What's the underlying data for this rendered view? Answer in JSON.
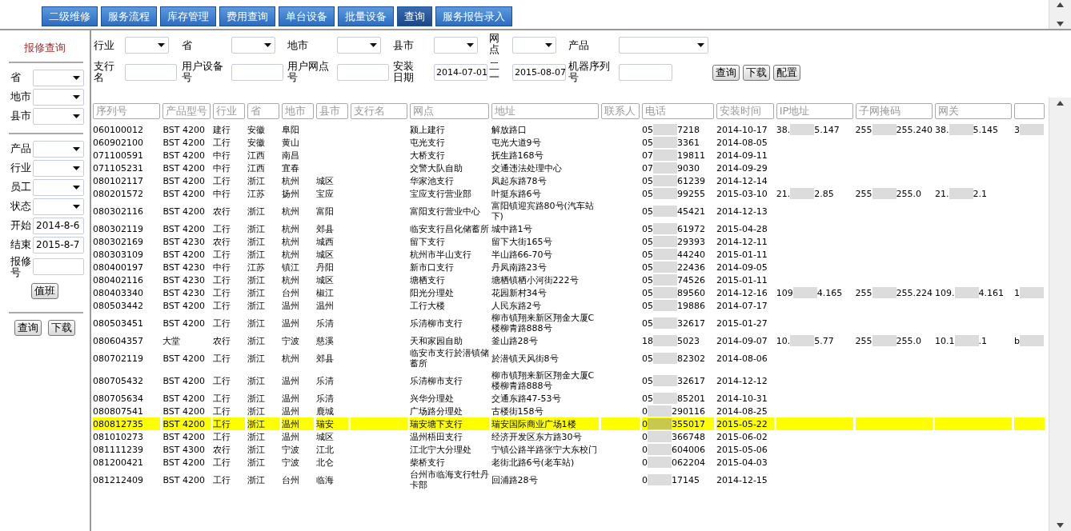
{
  "tabs": [
    {
      "label": "二级维修",
      "selected": false
    },
    {
      "label": "服务流程",
      "selected": false
    },
    {
      "label": "库存管理",
      "selected": false
    },
    {
      "label": "费用查询",
      "selected": false
    },
    {
      "label": "单台设备",
      "selected": false
    },
    {
      "label": "批量设备",
      "selected": false
    },
    {
      "label": "查询",
      "selected": true
    },
    {
      "label": "服务报告录入",
      "selected": false
    }
  ],
  "sidebar": {
    "title": "报修查询",
    "groups": [
      [
        {
          "kind": "select",
          "label": "省"
        },
        {
          "kind": "select",
          "label": "地市"
        },
        {
          "kind": "select",
          "label": "县市"
        }
      ],
      [
        {
          "kind": "select",
          "label": "产品"
        },
        {
          "kind": "select",
          "label": "行业"
        },
        {
          "kind": "select",
          "label": "员工"
        },
        {
          "kind": "select",
          "label": "状态"
        },
        {
          "kind": "input",
          "label": "开始",
          "value": "2014-8-6"
        },
        {
          "kind": "input",
          "label": "结束",
          "value": "2015-8-7"
        },
        {
          "kind": "input",
          "label": "报修号"
        }
      ]
    ],
    "duty_button": "值班",
    "buttons": [
      "查询",
      "下载"
    ]
  },
  "filters": {
    "rows": [
      [
        {
          "kind": "select",
          "label": "行业"
        },
        {
          "kind": "select",
          "label": "省"
        },
        {
          "kind": "select",
          "label": "地市"
        },
        {
          "kind": "select",
          "label": "县市"
        },
        {
          "kind": "select",
          "label": "网点"
        },
        {
          "kind": "select",
          "label": "产品"
        }
      ],
      [
        {
          "kind": "input",
          "label": "支行名"
        },
        {
          "kind": "input",
          "label": "用户设备号"
        },
        {
          "kind": "input",
          "label": "用户网点号"
        },
        {
          "kind": "input",
          "label": "安装日期",
          "value": "2014-07-01"
        },
        {
          "kind": "input",
          "label": "二一",
          "value": "2015-08-07"
        },
        {
          "kind": "input",
          "label": "机器序列号"
        }
      ]
    ],
    "buttons": [
      "查询",
      "下载",
      "配置"
    ]
  },
  "table": {
    "columns": [
      "序列号",
      "产品型号",
      "行业",
      "省",
      "地市",
      "县市",
      "支行名",
      "网点",
      "地址",
      "联系人",
      "电话",
      "安装时间",
      "IP地址",
      "子网掩码",
      "网关"
    ],
    "rows": [
      {
        "selected": false,
        "cells": [
          "060100012",
          "BST 4200",
          "建行",
          "安徽",
          "阜阳",
          "",
          "",
          "颍上建行",
          "解放路口",
          "",
          [
            "05",
            "7218"
          ],
          "2014-10-17",
          [
            "38.",
            "5.147"
          ],
          [
            "255",
            "255.240"
          ],
          [
            "38.",
            "5.145"
          ],
          [
            "3"
          ]
        ]
      },
      {
        "selected": false,
        "cells": [
          "060902100",
          "BST 4200",
          "工行",
          "安徽",
          "黄山",
          "",
          "",
          "屯光支行",
          "屯光大道9号",
          "",
          [
            "05",
            "3361"
          ],
          "2014-08-05"
        ]
      },
      {
        "selected": false,
        "cells": [
          "071100591",
          "BST 4200",
          "中行",
          "江西",
          "南昌",
          "",
          "",
          "大桥支行",
          "抚生路168号",
          "",
          [
            "07",
            "19811"
          ],
          "2014-09-11"
        ]
      },
      {
        "selected": false,
        "cells": [
          "071105231",
          "BST 4200",
          "中行",
          "江西",
          "宜春",
          "",
          "",
          "交警大队自助",
          "交通违法处理中心",
          "",
          [
            "07",
            "9030"
          ],
          "2014-09-29"
        ]
      },
      {
        "selected": false,
        "cells": [
          "080102117",
          "BST 4200",
          "工行",
          "浙江",
          "杭州",
          "城区",
          "",
          "华家池支行",
          "凤起东路78号",
          "",
          [
            "05",
            "61239"
          ],
          "2014-12-14"
        ]
      },
      {
        "selected": false,
        "cells": [
          "080201572",
          "BST 4200",
          "中行",
          "江苏",
          "扬州",
          "宝应",
          "",
          "宝应支行营业部",
          "叶挺东路6号",
          "",
          [
            "05",
            "99255"
          ],
          "2015-03-10",
          [
            "21.",
            "2.85"
          ],
          [
            "255",
            "255.0"
          ],
          [
            "21.",
            "2.1"
          ]
        ]
      },
      {
        "selected": false,
        "cells": [
          "080302116",
          "BST 4200",
          "农行",
          "浙江",
          "杭州",
          "富阳",
          "",
          "富阳支行营业中心",
          "富阳镇迎宾路80号(汽车站下)",
          "",
          [
            "05",
            "45421"
          ],
          "2014-12-13"
        ]
      },
      {
        "selected": false,
        "cells": [
          "080302119",
          "BST 4200",
          "工行",
          "浙江",
          "杭州",
          "郊县",
          "",
          "临安支行昌化储蓄所",
          "城中路1号",
          "",
          [
            "05",
            "61972"
          ],
          "2015-04-28"
        ]
      },
      {
        "selected": false,
        "cells": [
          "080302169",
          "BST 4230",
          "农行",
          "浙江",
          "杭州",
          "城西",
          "",
          "留下支行",
          "留下大街165号",
          "",
          [
            "05",
            "29393"
          ],
          "2014-12-11"
        ]
      },
      {
        "selected": false,
        "cells": [
          "080303109",
          "BST 4200",
          "工行",
          "浙江",
          "杭州",
          "城区",
          "",
          "杭州市半山支行",
          "半山路66-70号",
          "",
          [
            "05",
            "44240"
          ],
          "2015-01-11"
        ]
      },
      {
        "selected": false,
        "cells": [
          "080400197",
          "BST 4230",
          "中行",
          "江苏",
          "镇江",
          "丹阳",
          "",
          "新市口支行",
          "丹凤南路23号",
          "",
          [
            "05",
            "22436"
          ],
          "2014-09-05"
        ]
      },
      {
        "selected": false,
        "cells": [
          "080402116",
          "BST 4230",
          "工行",
          "浙江",
          "杭州",
          "城区",
          "",
          "塘栖支行",
          "塘栖镇栖小河街222号",
          "",
          [
            "05",
            "74526"
          ],
          "2015-01-11"
        ]
      },
      {
        "selected": false,
        "cells": [
          "080403340",
          "BST 4230",
          "工行",
          "浙江",
          "台州",
          "椒江",
          "",
          "阳光分理处",
          "花园新村34号",
          "",
          [
            "05",
            "89560"
          ],
          "2014-12-16",
          [
            "109",
            "4.165"
          ],
          [
            "255",
            "255.224"
          ],
          [
            "109.",
            "4.161"
          ],
          [
            "1"
          ]
        ]
      },
      {
        "selected": false,
        "cells": [
          "080503442",
          "BST 4200",
          "工行",
          "浙江",
          "温州",
          "温州",
          "",
          "工行大楼",
          "人民东路2号",
          "",
          [
            "05",
            "19886"
          ],
          "2014-07-17"
        ]
      },
      {
        "selected": false,
        "cells": [
          "080503451",
          "BST 4200",
          "工行",
          "浙江",
          "温州",
          "乐清",
          "",
          "乐清柳市支行",
          "柳市镇翔来新区翔金大厦C楼柳青路888号",
          "",
          [
            "05",
            "32617"
          ],
          "2015-01-27"
        ]
      },
      {
        "selected": false,
        "cells": [
          "080604357",
          "大堂",
          "农行",
          "浙江",
          "宁波",
          "慈溪",
          "",
          "天和家园自助",
          "釜山路28号",
          "",
          [
            "18",
            "5023"
          ],
          "2014-09-07",
          [
            "10.",
            "5.77"
          ],
          [
            "255",
            "255.0"
          ],
          [
            "10.1",
            ".1"
          ],
          [
            "b"
          ]
        ]
      },
      {
        "selected": false,
        "cells": [
          "080702119",
          "BST 4200",
          "工行",
          "浙江",
          "杭州",
          "郊县",
          "",
          "临安市支行於潜镇储蓄所",
          "於潜镇天风街8号",
          "",
          [
            "05",
            "82302"
          ],
          "2014-08-06"
        ]
      },
      {
        "selected": false,
        "cells": [
          "080705432",
          "BST 4200",
          "工行",
          "浙江",
          "温州",
          "乐清",
          "",
          "乐清柳市支行",
          "柳市镇翔来新区翔金大厦C楼柳青路888号",
          "",
          [
            "05",
            "32617"
          ],
          "2014-12-12"
        ]
      },
      {
        "selected": false,
        "cells": [
          "080705634",
          "BST 4200",
          "工行",
          "浙江",
          "温州",
          "乐清",
          "",
          "兴华分理处",
          "交通东路47-53号",
          "",
          [
            "05",
            "85201"
          ],
          "2014-10-31"
        ]
      },
      {
        "selected": false,
        "cells": [
          "080807541",
          "BST 4200",
          "工行",
          "浙江",
          "温州",
          "鹿城",
          "",
          "广场路分理处",
          "古楼街158号",
          "",
          [
            "0",
            "290116"
          ],
          "2014-08-25"
        ]
      },
      {
        "selected": true,
        "cells": [
          "080812735",
          "BST 4200",
          "工行",
          "浙江",
          "温州",
          "瑞安",
          "",
          "瑞安塘下支行",
          "瑞安国际商业广场1楼",
          "",
          [
            "0",
            "355017"
          ],
          "2015-05-22"
        ]
      },
      {
        "selected": false,
        "cells": [
          "081010273",
          "BST 4200",
          "工行",
          "浙江",
          "温州",
          "城区",
          "",
          "温州梧田支行",
          "经济开发区东方路30号",
          "",
          [
            "0",
            "366748"
          ],
          "2015-06-02"
        ]
      },
      {
        "selected": false,
        "cells": [
          "081111239",
          "BST 4300",
          "农行",
          "浙江",
          "宁波",
          "江北",
          "",
          "江北宁大分理处",
          "宁镇公路半路张宁大东校门",
          "",
          [
            "0",
            "604006"
          ],
          "2015-05-06"
        ]
      },
      {
        "selected": false,
        "cells": [
          "081200421",
          "BST 4200",
          "工行",
          "浙江",
          "宁波",
          "北仑",
          "",
          "柴桥支行",
          "老街北路6号(老车站)",
          "",
          [
            "0",
            "062204"
          ],
          "2015-04-03"
        ]
      },
      {
        "selected": false,
        "cells": [
          "081212409",
          "BST 4200",
          "工行",
          "浙江",
          "台州",
          "临海",
          "",
          "台州市临海支行牡丹卡部",
          "回浦路28号",
          "",
          [
            "0",
            "17145"
          ],
          "2014-12-15"
        ]
      }
    ]
  }
}
